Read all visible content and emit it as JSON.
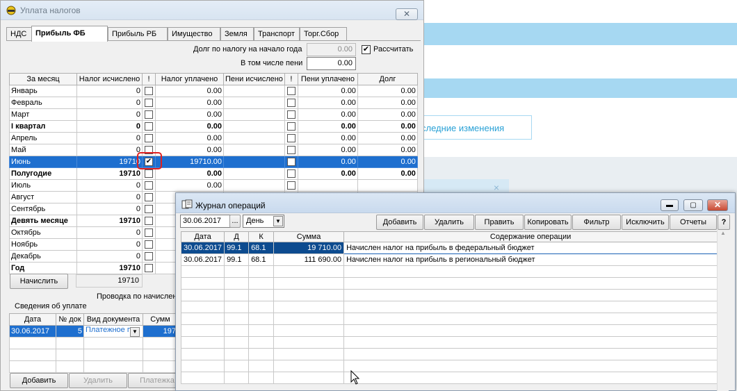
{
  "background": {
    "link_text": "следние изменения",
    "close_glyph": "×"
  },
  "main_window": {
    "title": "Уплата налогов",
    "tabs": [
      "НДС",
      "Прибыль ФБ",
      "Прибыль РБ",
      "Имущество",
      "Земля",
      "Транспорт",
      "Торг.Сбор"
    ],
    "active_tab": "Прибыль ФБ",
    "debt_label": "Долг по налогу на начало года",
    "debt_value": "0.00",
    "penalty_label": "В том числе пени",
    "penalty_value": "0.00",
    "recalc_label": "Рассчитать",
    "recalc_checked": true,
    "grid_headers": [
      "За месяц",
      "Налог исчислено",
      "!",
      "Налог уплачено",
      "Пени исчислено",
      "!",
      "Пени уплачено",
      "Долг"
    ],
    "rows": [
      {
        "month": "Январь",
        "tax_calc": "0",
        "tax_paid": "0.00",
        "pen_calc": "",
        "pen_paid": "0.00",
        "debt": "0.00",
        "bold": false,
        "sel": false
      },
      {
        "month": "Февраль",
        "tax_calc": "0",
        "tax_paid": "0.00",
        "pen_calc": "",
        "pen_paid": "0.00",
        "debt": "0.00",
        "bold": false,
        "sel": false
      },
      {
        "month": "Март",
        "tax_calc": "0",
        "tax_paid": "0.00",
        "pen_calc": "",
        "pen_paid": "0.00",
        "debt": "0.00",
        "bold": false,
        "sel": false
      },
      {
        "month": "I квартал",
        "tax_calc": "0",
        "tax_paid": "0.00",
        "pen_calc": "",
        "pen_paid": "0.00",
        "debt": "0.00",
        "bold": true,
        "sel": false
      },
      {
        "month": "Апрель",
        "tax_calc": "0",
        "tax_paid": "0.00",
        "pen_calc": "",
        "pen_paid": "0.00",
        "debt": "0.00",
        "bold": false,
        "sel": false
      },
      {
        "month": "Май",
        "tax_calc": "0",
        "tax_paid": "0.00",
        "pen_calc": "",
        "pen_paid": "0.00",
        "debt": "0.00",
        "bold": false,
        "sel": false
      },
      {
        "month": "Июнь",
        "tax_calc": "19710",
        "tax_paid": "19710.00",
        "pen_calc": "",
        "pen_paid": "0.00",
        "debt": "0.00",
        "bold": false,
        "sel": true,
        "checked": true
      },
      {
        "month": "Полугодие",
        "tax_calc": "19710",
        "tax_paid": "0.00",
        "pen_calc": "",
        "pen_paid": "0.00",
        "debt": "0.00",
        "bold": true,
        "sel": false
      },
      {
        "month": "Июль",
        "tax_calc": "0",
        "tax_paid": "0.00",
        "pen_calc": "",
        "pen_paid": "",
        "debt": "",
        "bold": false,
        "sel": false
      },
      {
        "month": "Август",
        "tax_calc": "0",
        "tax_paid": "",
        "pen_calc": "",
        "pen_paid": "",
        "debt": "",
        "bold": false,
        "sel": false
      },
      {
        "month": "Сентябрь",
        "tax_calc": "0",
        "tax_paid": "",
        "pen_calc": "",
        "pen_paid": "",
        "debt": "",
        "bold": false,
        "sel": false
      },
      {
        "month": "Девять месяце",
        "tax_calc": "19710",
        "tax_paid": "",
        "pen_calc": "",
        "pen_paid": "",
        "debt": "",
        "bold": true,
        "sel": false
      },
      {
        "month": "Октябрь",
        "tax_calc": "0",
        "tax_paid": "",
        "pen_calc": "",
        "pen_paid": "",
        "debt": "",
        "bold": false,
        "sel": false
      },
      {
        "month": "Ноябрь",
        "tax_calc": "0",
        "tax_paid": "",
        "pen_calc": "",
        "pen_paid": "",
        "debt": "",
        "bold": false,
        "sel": false
      },
      {
        "month": "Декабрь",
        "tax_calc": "0",
        "tax_paid": "",
        "pen_calc": "",
        "pen_paid": "",
        "debt": "",
        "bold": false,
        "sel": false
      },
      {
        "month": "Год",
        "tax_calc": "19710",
        "tax_paid": "",
        "pen_calc": "",
        "pen_paid": "",
        "debt": "",
        "bold": true,
        "sel": false
      }
    ],
    "calc_button": "Начислить",
    "total_tax": "19710",
    "posting_label": "Проводка  по начислени",
    "payment_info_label": "Сведения об уплате",
    "payment_headers": [
      "Дата",
      "№ док",
      "Вид документа",
      "Сумм"
    ],
    "payments": [
      {
        "date": "30.06.2017",
        "num": "5",
        "type": "Платежное п",
        "sum": "197"
      }
    ],
    "add_button": "Добавить",
    "delete_button": "Удалить",
    "payment_button": "Платежка"
  },
  "journal": {
    "title": "Журнал операций",
    "date_value": "30.06.2017",
    "ellipsis": "...",
    "period_value": "День",
    "toolbar": [
      "Добавить",
      "Удалить",
      "Править",
      "Копировать",
      "Фильтр",
      "Исключить",
      "Отчеты",
      "?"
    ],
    "headers": [
      "Дата",
      "Д",
      "К",
      "Сумма",
      "Содержание операции"
    ],
    "rows": [
      {
        "date": "30.06.2017",
        "d": "99.1",
        "k": "68.1",
        "sum": "19 710.00",
        "content": "Начислен налог на прибыль в федеральный бюджет",
        "sel": true
      },
      {
        "date": "30.06.2017",
        "d": "99.1",
        "k": "68.1",
        "sum": "111 690.00",
        "content": "Начислен налог на прибыль в региональный бюджет",
        "sel": false
      }
    ],
    "empty_rows": 10
  }
}
